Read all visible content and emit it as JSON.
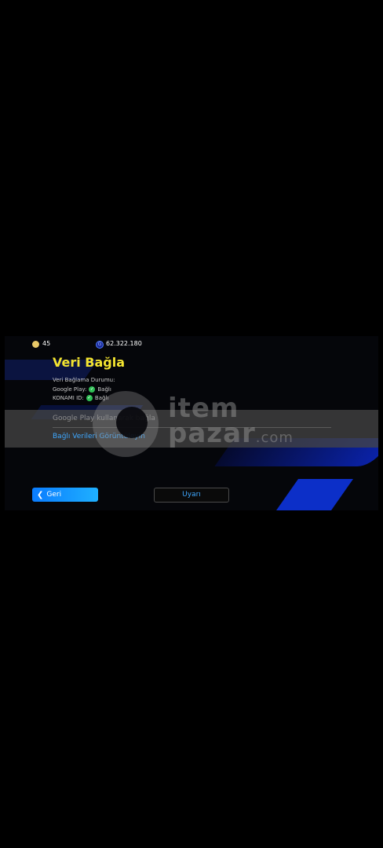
{
  "topbar": {
    "coins": "45",
    "gp": "62.322.180",
    "gp_symbol": "G"
  },
  "title": "Veri Bağla",
  "status": {
    "label": "Veri Bağlama Durumu:",
    "rows": [
      {
        "service": "Google Play:",
        "state": "Bağlı"
      },
      {
        "service": "KONAMI ID:",
        "state": "Bağlı"
      }
    ]
  },
  "actions": {
    "link_google_play": "Google Play kullanarak bağla",
    "view_linked_data": "Bağlı Verileri Görüntüleyin"
  },
  "watermark": {
    "line1": "item",
    "line2": "pazar",
    "line3": ".com"
  },
  "buttons": {
    "back": "Geri",
    "warning": "Uyarı"
  },
  "colors": {
    "title": "#f4e530",
    "link": "#3fa8ff",
    "accent_blue": "#0a7cff",
    "success": "#2fbf55"
  }
}
